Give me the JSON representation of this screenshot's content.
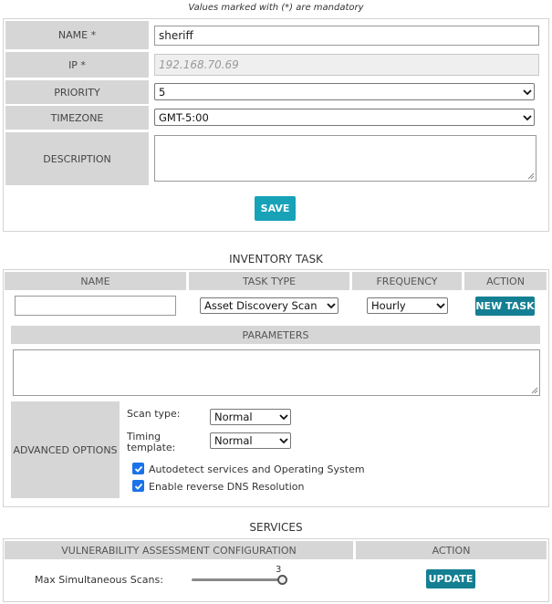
{
  "note": "Values marked with (*) are mandatory",
  "sensor_form": {
    "name_label": "NAME *",
    "name_value": "sheriff",
    "ip_label": "IP *",
    "ip_placeholder": "192.168.70.69",
    "priority_label": "PRIORITY",
    "priority_value": "5",
    "timezone_label": "TIMEZONE",
    "timezone_value": "GMT-5:00",
    "description_label": "DESCRIPTION",
    "description_value": "",
    "save_label": "SAVE"
  },
  "inventory": {
    "title": "INVENTORY TASK",
    "columns": [
      "NAME",
      "TASK TYPE",
      "FREQUENCY",
      "ACTION"
    ],
    "name_value": "",
    "task_type_value": "Asset Discovery Scan",
    "frequency_value": "Hourly",
    "new_task_label": "NEW TASK",
    "parameters_label": "PARAMETERS",
    "parameters_value": "",
    "advanced_label": "ADVANCED OPTIONS",
    "scan_type_label": "Scan type:",
    "scan_type_value": "Normal",
    "timing_label_line1": "Timing",
    "timing_label_line2": "template:",
    "timing_value": "Normal",
    "autodetect_label": "Autodetect services and Operating System",
    "autodetect_checked": true,
    "reverse_dns_label": "Enable reverse DNS Resolution",
    "reverse_dns_checked": true
  },
  "services": {
    "title": "SERVICES",
    "col_config": "VULNERABILITY ASSESSMENT CONFIGURATION",
    "col_action": "ACTION",
    "max_scans_label": "Max Simultaneous Scans:",
    "max_scans_value": "3",
    "slider_fraction": 1.0,
    "update_label": "UPDATE"
  },
  "colors": {
    "accent": "#17a2b8",
    "label_bg": "#d6d6d6",
    "checkbox": "#1a73e8"
  }
}
